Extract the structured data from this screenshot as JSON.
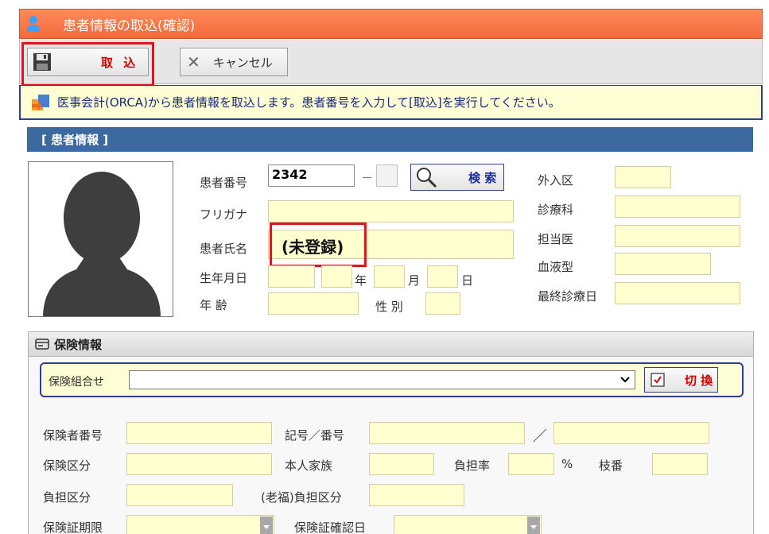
{
  "window": {
    "title": "患者情報の取込(確認)"
  },
  "toolbar": {
    "import_label": "取 込",
    "cancel_label": "キャンセル"
  },
  "info": {
    "message": "医事会計(ORCA)から患者情報を取込します。患者番号を入力して[取込]を実行してください。"
  },
  "patient_section": {
    "title": "[ 患者情報 ]",
    "labels": {
      "patient_number": "患者番号",
      "kana": "フリガナ",
      "name": "患者氏名",
      "birthdate": "生年月日",
      "year": "年",
      "month": "月",
      "day": "日",
      "age": "年 齢",
      "gender": "性 別",
      "inout": "外入区",
      "department": "診療科",
      "doctor": "担当医",
      "blood": "血液型",
      "last_visit": "最終診療日"
    },
    "patient_number_value": "2342",
    "dash": "－",
    "search_label": "検 索",
    "name_value": "(未登録)"
  },
  "insurance_section": {
    "title": "保険情報",
    "combo_label": "保険組合せ",
    "switch_label": "切 換",
    "labels": {
      "insurer_number": "保険者番号",
      "symbol_number": "記号／番号",
      "slash": "／",
      "insurance_class": "保険区分",
      "person_family": "本人家族",
      "burden_rate": "負担率",
      "percent": "%",
      "branch": "枝番",
      "burden_class": "負担区分",
      "elderly_burden": "(老福)負担区分",
      "card_period": "保険証期限",
      "card_confirm": "保険証確認日"
    }
  },
  "colors": {
    "title_bar": "#f26a3c",
    "section_header": "#3d6a9e",
    "highlight": "#e0141e",
    "field_bg": "#ffffd0"
  }
}
